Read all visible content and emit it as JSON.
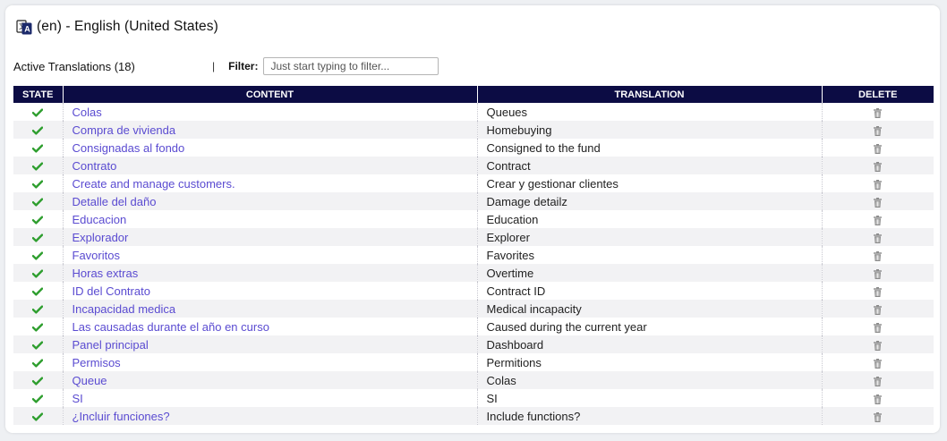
{
  "header": {
    "title": "(en) - English (United States)",
    "icon": "translate-icon"
  },
  "toolbar": {
    "active_label": "Active Translations (18)",
    "separator": "|",
    "filter_label": "Filter:",
    "filter_placeholder": "Just start typing to filter...",
    "filter_value": ""
  },
  "table": {
    "columns": [
      "STATE",
      "CONTENT",
      "TRANSLATION",
      "DELETE"
    ],
    "rows": [
      {
        "state": "active",
        "content": "Colas",
        "translation": "Queues"
      },
      {
        "state": "active",
        "content": "Compra de vivienda",
        "translation": "Homebuying"
      },
      {
        "state": "active",
        "content": "Consignadas al fondo",
        "translation": "Consigned to the fund"
      },
      {
        "state": "active",
        "content": "Contrato",
        "translation": "Contract"
      },
      {
        "state": "active",
        "content": "Create and manage customers.",
        "translation": "Crear y gestionar clientes"
      },
      {
        "state": "active",
        "content": "Detalle del daño",
        "translation": "Damage detailz"
      },
      {
        "state": "active",
        "content": "Educacion",
        "translation": "Education"
      },
      {
        "state": "active",
        "content": "Explorador",
        "translation": "Explorer"
      },
      {
        "state": "active",
        "content": "Favoritos",
        "translation": "Favorites"
      },
      {
        "state": "active",
        "content": "Horas extras",
        "translation": "Overtime"
      },
      {
        "state": "active",
        "content": "ID del Contrato",
        "translation": "Contract ID"
      },
      {
        "state": "active",
        "content": "Incapacidad medica",
        "translation": "Medical incapacity"
      },
      {
        "state": "active",
        "content": "Las causadas durante el año en curso",
        "translation": "Caused during the current year"
      },
      {
        "state": "active",
        "content": "Panel principal",
        "translation": "Dashboard"
      },
      {
        "state": "active",
        "content": "Permisos",
        "translation": "Permitions"
      },
      {
        "state": "active",
        "content": "Queue",
        "translation": "Colas"
      },
      {
        "state": "active",
        "content": "SI",
        "translation": "SI"
      },
      {
        "state": "active",
        "content": "¿Incluir funciones?",
        "translation": "Include functions?"
      }
    ]
  },
  "colors": {
    "header_bg": "#0c0c44",
    "link": "#5a4bd1",
    "check": "#2e9e2e",
    "trash": "#8a8a8a"
  }
}
